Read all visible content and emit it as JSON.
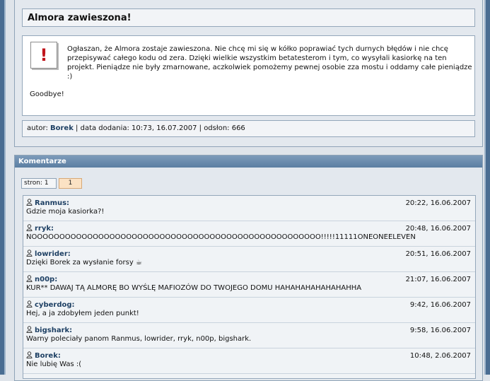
{
  "news": {
    "title": "Almora zawieszona!",
    "body": "Ogłaszan, że Almora zostaje zawieszona. Nie chcę mi się w kółko poprawiać tych durnych błędów i nie chcę przepisywać całego kodu od zera. Dzięki wielkie wszystkim betatesterom i tym, co wysyłali kasiorkę na ten projekt. Pieniądze nie były zmarnowane, aczkolwiek pomożemy pewnej osobie zza mostu i oddamy całe pieniądze :)",
    "goodbye": "Goodbye!",
    "meta_prefix": "autor:",
    "author": "Borek",
    "meta_suffix": "| data dodania: 10:73, 16.07.2007 | odsłon: 666"
  },
  "comments_section": {
    "header": "Komentarze",
    "pager_label": "stron: 1",
    "current_page": "1",
    "items": [
      {
        "user": "Ranmus:",
        "date": "20:22, 16.06.2007",
        "text": "Gdzie moja kasiorka?!"
      },
      {
        "user": "rryk:",
        "date": "20:48, 16.06.2007",
        "text": "NOOOOOOOOOOOOOOOOOOOOOOOOOOOOOOOOOOOOOOOOOOOOOOOOOOOO!!!!!11111ONEONEELEVEN"
      },
      {
        "user": "lowrider:",
        "date": "20:51, 16.06.2007",
        "text": "Dzięki Borek za wysłanie forsy ☕"
      },
      {
        "user": "n00p:",
        "date": "21:07, 16.06.2007",
        "text": "KUR** DAWAJ TĄ ALMORĘ BO WYŚLĘ MAFIOZÓW DO TWOJEGO DOMU HAHAHAHAHAHAHAHHA"
      },
      {
        "user": "cyberdog:",
        "date": "9:42, 16.06.2007",
        "text": "Hej, a ja zdobyłem jeden punkt!"
      },
      {
        "user": "bigshark:",
        "date": "9:58, 16.06.2007",
        "text": "Warny poleciały panom Ranmus, lowrider, rryk, n00p, bigshark."
      },
      {
        "user": "Borek:",
        "date": "10:48, 2.06.2007",
        "text": "Nie lubię Was :("
      }
    ]
  },
  "colors": {
    "frame": "#4a6d92",
    "alert_red": "#c0141b",
    "username": "#1d3f63",
    "page_active_bg": "#fbe2c4"
  },
  "icons": {
    "alert": "exclamation-icon",
    "user": "person-icon"
  }
}
